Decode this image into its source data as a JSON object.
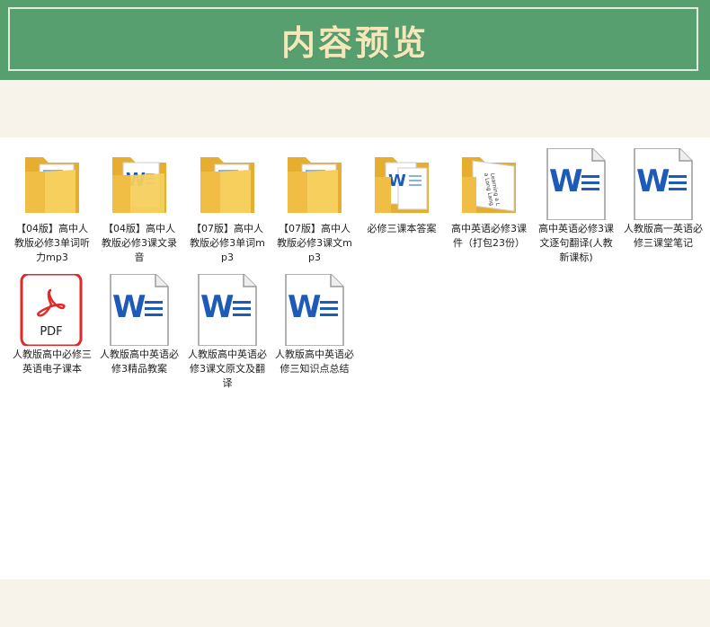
{
  "header": {
    "title": "内容预览"
  },
  "files": [
    {
      "name": "【04版】高中人教版必修3单词听力mp3",
      "icon": "folder-docs-icon"
    },
    {
      "name": "【04版】高中人教版必修3课文录音",
      "icon": "folder-word-icon"
    },
    {
      "name": "【07版】高中人教版必修3单词mp3",
      "icon": "folder-docs-icon"
    },
    {
      "name": "【07版】高中人教版必修3课文mp3",
      "icon": "folder-docs-icon"
    },
    {
      "name": "必修三课本答案",
      "icon": "folder-word-docs-icon"
    },
    {
      "name": "高中英语必修3课件（打包23份）",
      "icon": "folder-slides-icon"
    },
    {
      "name": "高中英语必修3课文逐句翻译(人教新课标)",
      "icon": "word-document-icon"
    },
    {
      "name": "人教版高一英语必修三课堂笔记",
      "icon": "word-document-icon"
    },
    {
      "name": "人教版高中必修三英语电子课本",
      "icon": "pdf-document-icon"
    },
    {
      "name": "人教版高中英语必修3精品教案",
      "icon": "word-document-icon"
    },
    {
      "name": "人教版高中英语必修3课文原文及翻译",
      "icon": "word-document-icon"
    },
    {
      "name": "人教版高中英语必修三知识点总结",
      "icon": "word-document-icon"
    }
  ],
  "slide_preview_text": [
    "Learning a L",
    "...",
    "a Long Lang"
  ],
  "pdf_label": "PDF",
  "colors": {
    "banner": "#579f6f",
    "title": "#f4e7b9",
    "word_blue": "#1e5bb8",
    "pdf_red": "#e02a2a",
    "folder": "#f5c84c"
  }
}
